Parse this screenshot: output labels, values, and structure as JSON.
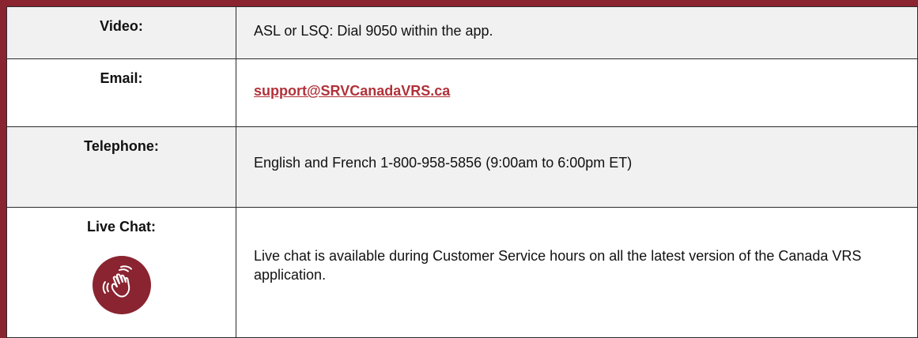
{
  "colors": {
    "border_accent": "#8a2430",
    "link": "#b0323a",
    "icon_fill": "#8a2430",
    "shaded_row": "#f1f1f1"
  },
  "rows": [
    {
      "label": "Video:",
      "value": "ASL or LSQ: Dial 9050 within the app."
    },
    {
      "label": "Email:",
      "value": "support@SRVCanadaVRS.ca"
    },
    {
      "label": "Telephone:",
      "value": "English and French 1-800-958-5856 (9:00am to 6:00pm ET)"
    },
    {
      "label": "Live Chat:",
      "value": "Live chat is available during Customer Service hours on all the latest version of the Canada VRS application.",
      "icon": "waving-hand-icon"
    }
  ]
}
